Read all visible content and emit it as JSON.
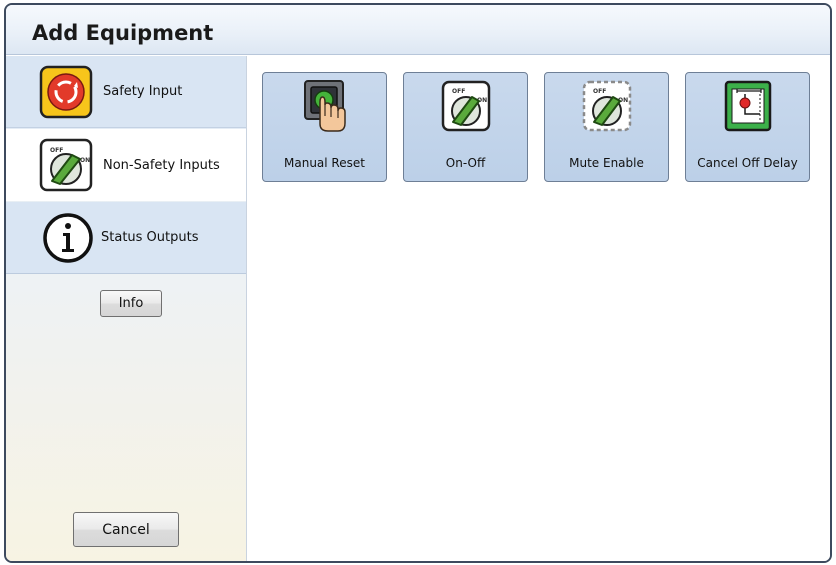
{
  "window": {
    "title": "Add Equipment"
  },
  "sidebar": {
    "items": [
      {
        "label": "Safety Input",
        "icon": "emergency-stop-icon",
        "selected": false
      },
      {
        "label": "Non-Safety Inputs",
        "icon": "selector-switch-icon",
        "selected": true
      },
      {
        "label": "Status Outputs",
        "icon": "info-circle-icon",
        "selected": false
      }
    ],
    "info_label": "Info",
    "cancel_label": "Cancel"
  },
  "main": {
    "tiles": [
      {
        "label": "Manual Reset",
        "icon": "push-button-hand-icon"
      },
      {
        "label": "On-Off",
        "icon": "on-off-switch-icon",
        "off_text": "OFF",
        "on_text": "ON"
      },
      {
        "label": "Mute Enable",
        "icon": "mute-enable-switch-icon",
        "off_text": "OFF",
        "on_text": "ON"
      },
      {
        "label": "Cancel Off Delay",
        "icon": "cancel-off-delay-icon"
      }
    ]
  },
  "colors": {
    "accent_blue": "#bcd0e8",
    "selected_item": "#ffffff",
    "switch_green": "#5aaa3c",
    "stop_red": "#e23a2a",
    "stop_yellow": "#f7c51b"
  }
}
